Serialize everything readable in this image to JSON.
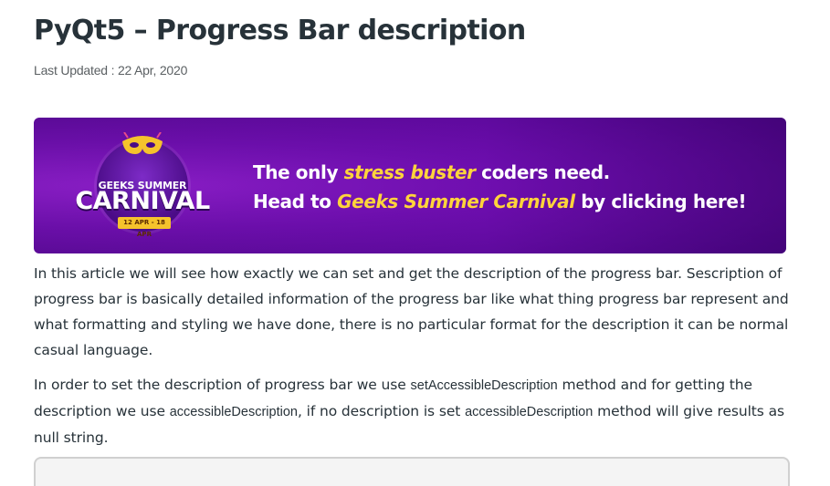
{
  "article": {
    "title": "PyQt5 – Progress Bar description",
    "last_updated": "Last Updated : 22 Apr, 2020"
  },
  "banner": {
    "badge_top": "GEEKS SUMMER",
    "badge_main": "CARNIVAL",
    "badge_date": "12 APR - 18 APR",
    "line1_a": "The only ",
    "line1_highlight": "stress buster",
    "line1_b": " coders need.",
    "line2_a": "Head to ",
    "line2_highlight": "Geeks Summer Carnival",
    "line2_b": " by clicking here!",
    "colors": {
      "background": "#6a0fa8",
      "highlight": "#ffd43b",
      "badge_date": "#f5c32c"
    }
  },
  "paragraph1": "In this article we will see how exactly we can set and get the description of the progress bar. Sescription of progress bar is basically detailed information of the progress bar like what thing progress bar represent and what formatting and styling we have done, there is no particular format for the description it can be normal casual language.",
  "paragraph2": {
    "t1": "In order to set the description of progress bar we use ",
    "c1": "setAccessibleDescription",
    "t2": " method and for getting the description we use ",
    "c2": "accessibleDescription",
    "t3": ", if no description is set ",
    "c3": "accessibleDescription",
    "t4": " method will give results as null string."
  }
}
